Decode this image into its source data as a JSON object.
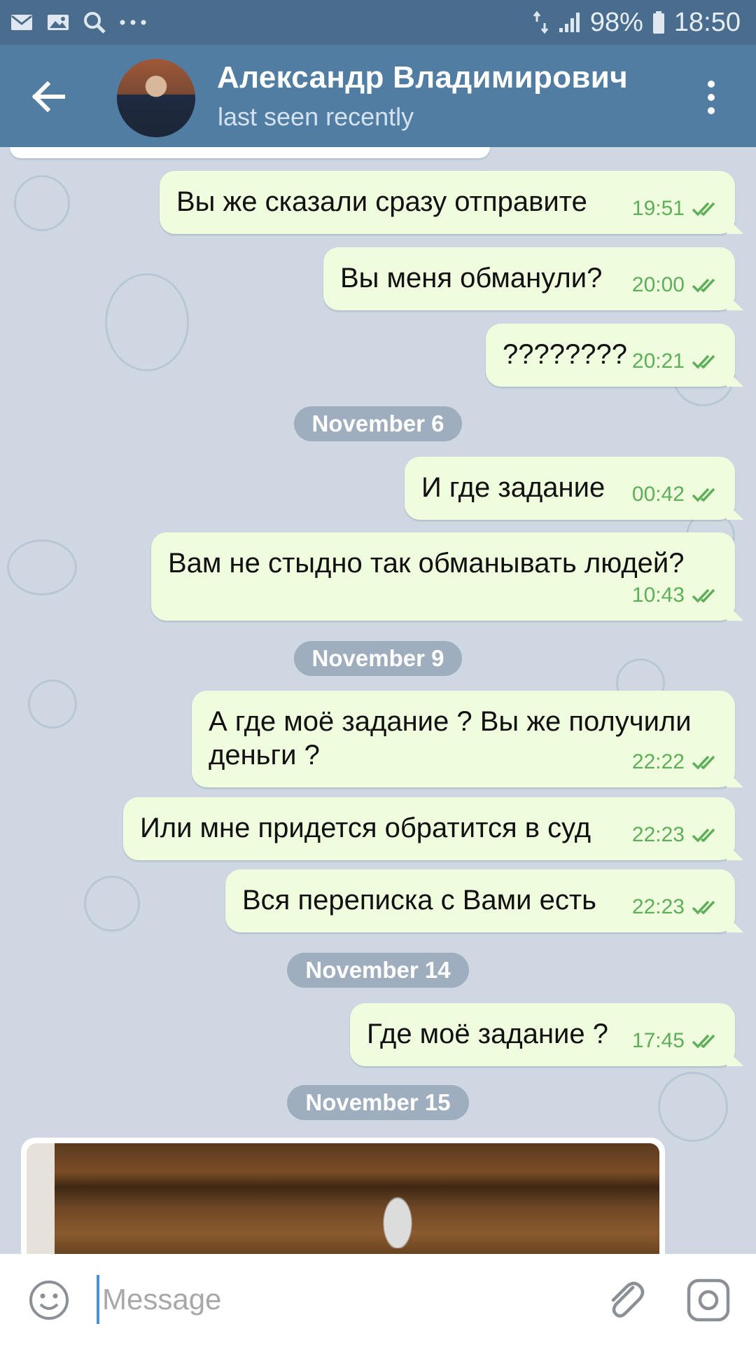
{
  "status_bar": {
    "battery": "98%",
    "time": "18:50",
    "left_icons": [
      "mail-icon",
      "image-icon",
      "search-icon",
      "more-dots-icon"
    ],
    "right_icons": [
      "data-arrows-icon",
      "signal-icon",
      "battery-icon"
    ]
  },
  "header": {
    "name": "Александр Владимирович",
    "status": "last seen recently"
  },
  "messages": [
    {
      "text": "Вы же сказали сразу отправите",
      "time": "19:51"
    },
    {
      "text": "Вы меня обманули?",
      "time": "20:00"
    },
    {
      "text": "????????",
      "time": "20:21"
    },
    {
      "date": "November 6"
    },
    {
      "text": "И где задание",
      "time": "00:42"
    },
    {
      "text": "Вам не стыдно так обманывать людей?",
      "time": "10:43"
    },
    {
      "date": "November 9"
    },
    {
      "text": "А где моё задание ? Вы же получили деньги ?",
      "time": "22:22"
    },
    {
      "text": "Или мне придется обратится в суд",
      "time": "22:23"
    },
    {
      "text": "Вся переписка с Вами есть",
      "time": "22:23"
    },
    {
      "date": "November 14"
    },
    {
      "text": "Где моё задание ?",
      "time": "17:45"
    },
    {
      "date": "November 15"
    }
  ],
  "composer": {
    "placeholder": "Message"
  },
  "colors": {
    "header": "#527da3",
    "status_bar": "#4a6d8d",
    "outgoing_bubble": "#effdde",
    "time_text": "#5fae5a",
    "chat_background": "#cfd8e2"
  }
}
